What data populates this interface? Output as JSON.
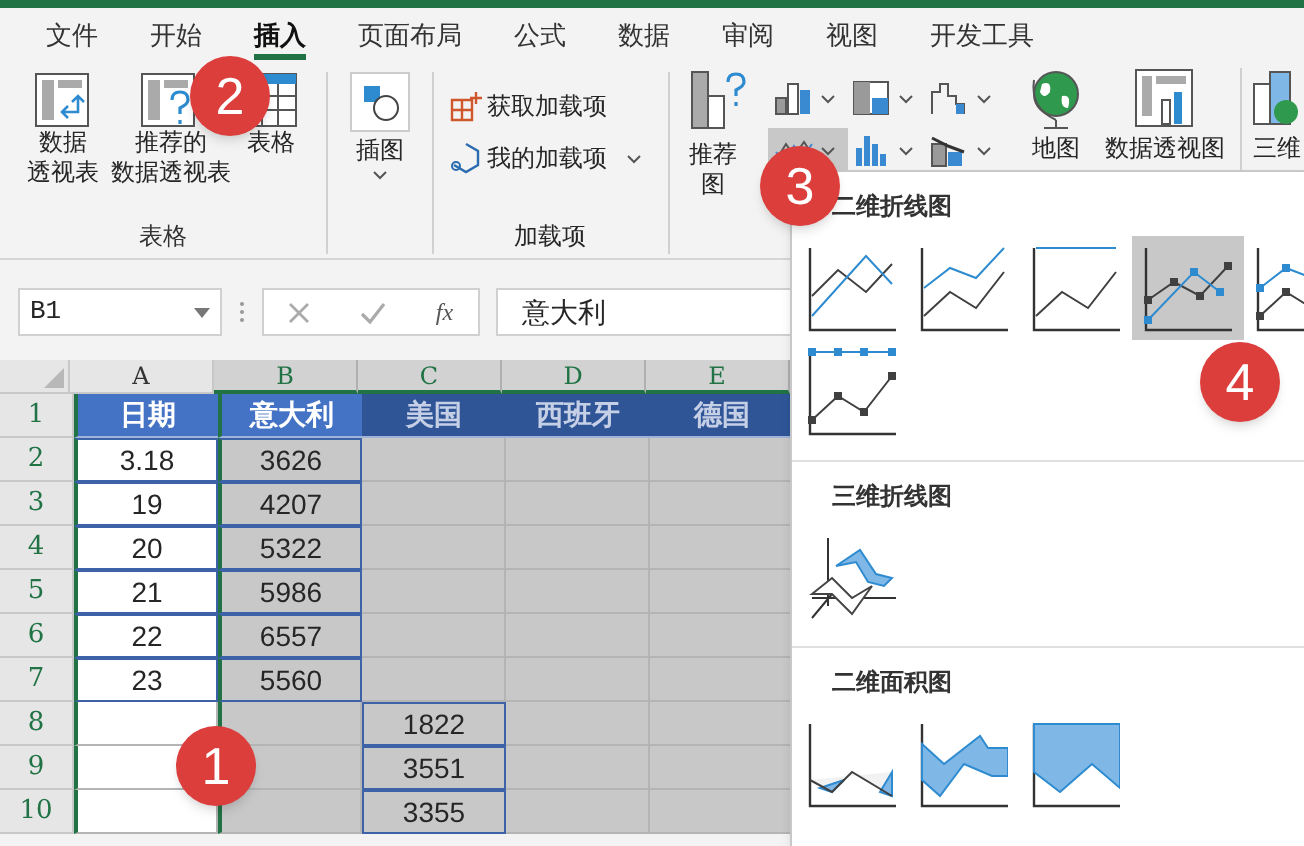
{
  "tabs": [
    {
      "label": "文件",
      "selected": false
    },
    {
      "label": "开始",
      "selected": false
    },
    {
      "label": "插入",
      "selected": true
    },
    {
      "label": "页面布局",
      "selected": false
    },
    {
      "label": "公式",
      "selected": false
    },
    {
      "label": "数据",
      "selected": false
    },
    {
      "label": "审阅",
      "selected": false
    },
    {
      "label": "视图",
      "selected": false
    },
    {
      "label": "开发工具",
      "selected": false
    }
  ],
  "ribbon": {
    "tables": {
      "label": "表格",
      "pivot": [
        "数据",
        "透视表"
      ],
      "recommended_pivot": [
        "推荐的",
        "数据透视表"
      ],
      "table": [
        "表格"
      ]
    },
    "illustrations": {
      "label": "插图"
    },
    "addins": {
      "label": "加载项",
      "get": "获取加载项",
      "mine": "我的加载项"
    },
    "charts": {
      "recommended": [
        "推荐",
        "图"
      ],
      "types": [
        {
          "kind": "column",
          "selected": false
        },
        {
          "kind": "hierarchy",
          "selected": false
        },
        {
          "kind": "waterfall",
          "selected": false
        },
        {
          "kind": "line",
          "selected": true
        },
        {
          "kind": "statistic",
          "selected": false
        },
        {
          "kind": "scatter",
          "selected": false
        }
      ],
      "map": "地图",
      "pivot_chart": "数据透视图",
      "map_3d": "三维"
    }
  },
  "formula_bar": {
    "name_box": "B1",
    "function_label": "fx",
    "value": "意大利"
  },
  "columns": [
    {
      "label": "A",
      "selected": false
    },
    {
      "label": "B",
      "selected": true
    },
    {
      "label": "C",
      "selected": true
    },
    {
      "label": "D",
      "selected": true
    },
    {
      "label": "E",
      "selected": true
    }
  ],
  "rows": [
    {
      "number": "1",
      "kind": "header",
      "cells": [
        {
          "text": "日期",
          "highlighted": true
        },
        {
          "text": "意大利",
          "highlighted": true
        },
        {
          "text": "美国",
          "highlighted": false
        },
        {
          "text": "西班牙",
          "highlighted": false
        },
        {
          "text": "德国",
          "highlighted": false
        }
      ]
    },
    {
      "number": "2",
      "kind": "data",
      "cells": [
        "3.18",
        "3626",
        null,
        null,
        null
      ]
    },
    {
      "number": "3",
      "kind": "data",
      "cells": [
        "19",
        "4207",
        null,
        null,
        null
      ]
    },
    {
      "number": "4",
      "kind": "data",
      "cells": [
        "20",
        "5322",
        null,
        null,
        null
      ]
    },
    {
      "number": "5",
      "kind": "data",
      "cells": [
        "21",
        "5986",
        null,
        null,
        null
      ]
    },
    {
      "number": "6",
      "kind": "data",
      "cells": [
        "22",
        "6557",
        null,
        null,
        null
      ]
    },
    {
      "number": "7",
      "kind": "data",
      "cells": [
        "23",
        "5560",
        null,
        null,
        null
      ]
    },
    {
      "number": "8",
      "kind": "data",
      "cells": [
        null,
        null,
        "1822",
        null,
        null
      ]
    },
    {
      "number": "9",
      "kind": "data",
      "cells": [
        null,
        null,
        "3551",
        null,
        null
      ]
    },
    {
      "number": "10",
      "kind": "data",
      "cells": [
        null,
        null,
        "3355",
        null,
        null
      ]
    }
  ],
  "chart_menu": {
    "sections": [
      {
        "title": "二维折线图",
        "charts": [
          {
            "kind": "line",
            "selected": false
          },
          {
            "kind": "stacked-line",
            "selected": false
          },
          {
            "kind": "percent-line",
            "selected": false
          },
          {
            "kind": "line-markers",
            "selected": true
          },
          {
            "kind": "stacked-line-markers",
            "selected": false
          },
          {
            "kind": "percent-line-markers",
            "selected": false
          }
        ]
      },
      {
        "title": "三维折线图",
        "charts": [
          {
            "kind": "line-3d",
            "selected": false
          }
        ]
      },
      {
        "title": "二维面积图",
        "charts": [
          {
            "kind": "area",
            "selected": false
          },
          {
            "kind": "stacked-area",
            "selected": false
          },
          {
            "kind": "percent-area",
            "selected": false
          }
        ]
      }
    ]
  },
  "callouts": [
    "1",
    "2",
    "3",
    "4"
  ]
}
